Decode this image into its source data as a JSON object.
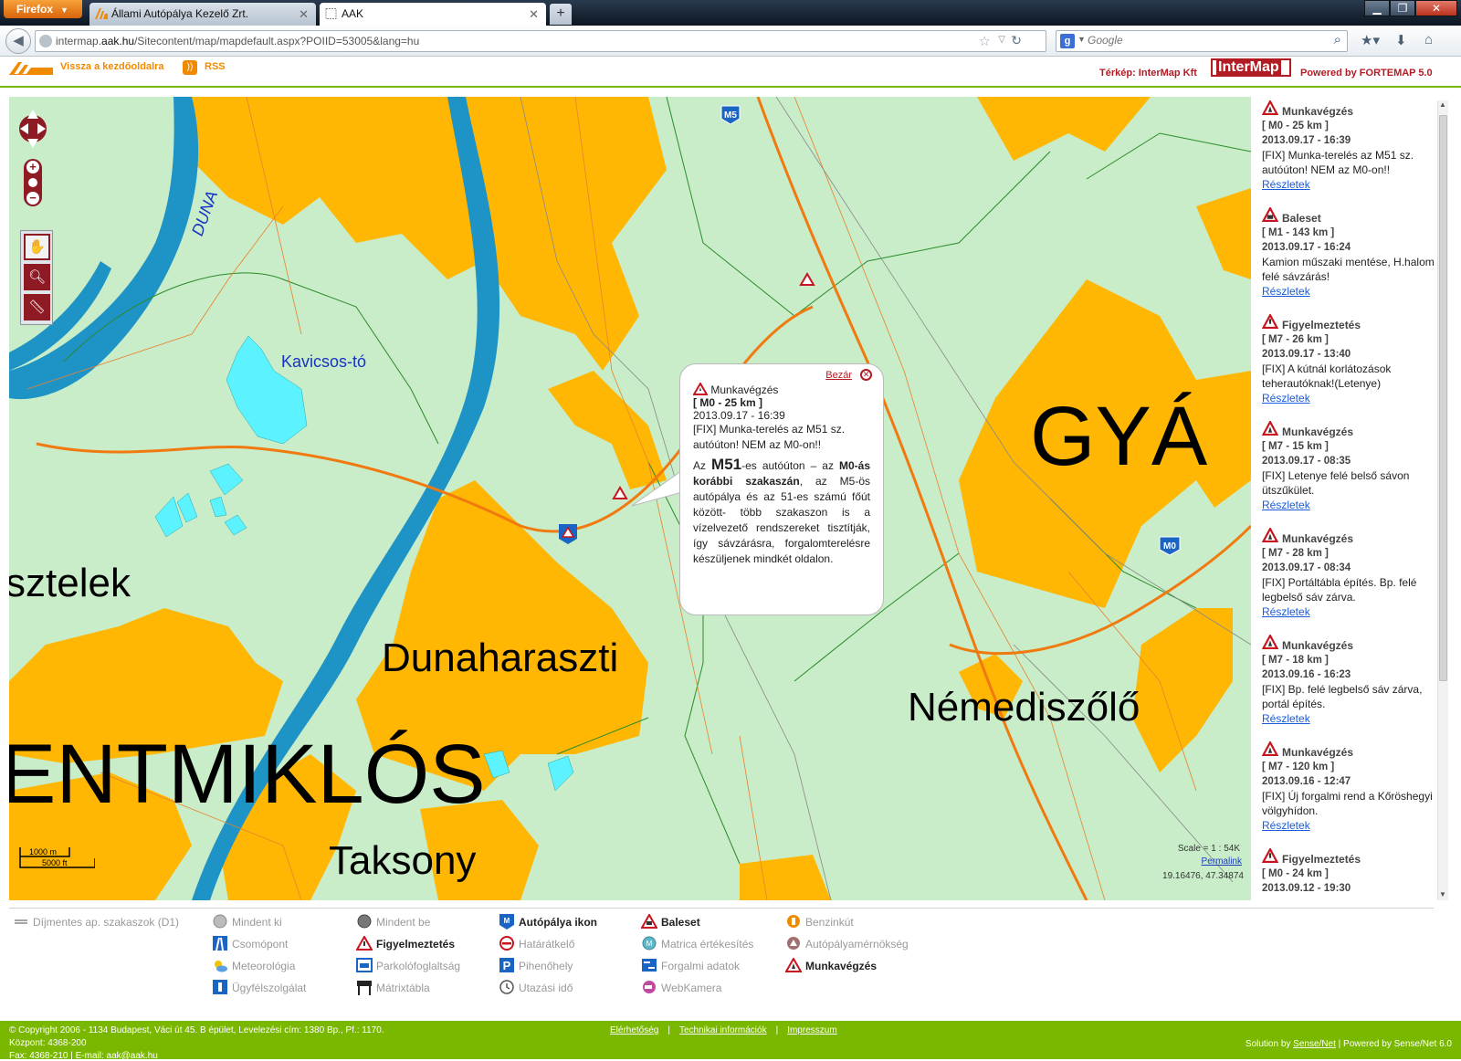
{
  "browser": {
    "menu_label": "Firefox",
    "tabs": [
      {
        "label": "Állami Autópálya Kezelő Zrt."
      },
      {
        "label": "AAK"
      }
    ],
    "url_prefix": "intermap.",
    "url_domain": "aak.hu",
    "url_rest": "/Sitecontent/map/mapdefault.aspx?POIID=53005&lang=hu",
    "search_placeholder": "Google"
  },
  "site_header": {
    "back_link": "Vissza a kezdőoldalra",
    "rss": "RSS",
    "map_credit": "Térkép: InterMap Kft",
    "intermap_logo": "InterMap",
    "powered_by": "Powered by FORTEMAP 5.0"
  },
  "map": {
    "labels": {
      "duna": "DUNA",
      "kavicsos_to": "Kavicsos-tó",
      "gya": "GYÁ",
      "sztelek": "sztelek",
      "dunaharaszti": "Dunaharaszti",
      "nemediszolo": "Némediszőlő",
      "entmiklos": "ENTMIKLÓS",
      "taksony": "Taksony"
    },
    "road_shields": {
      "m5": "M5",
      "m0": "M0"
    },
    "scale_m": "1000 m",
    "scale_ft": "5000 ft",
    "scale_ratio": "Scale = 1 : 54K",
    "permalink": "Permalink",
    "coords": "19.16476, 47.34874"
  },
  "popup": {
    "close_label": "Bezár",
    "type": "Munkavégzés",
    "km": "[ M0 - 25 km ]",
    "date": "2013.09.17 - 16:39",
    "title": "[FIX] Munka-terelés az M51 sz. autóúton! NEM az M0-on!!",
    "body_1": "Az ",
    "body_big": "M51",
    "body_2": "-es autóúton – az ",
    "body_bold": "M0-ás korábbi szakaszán",
    "body_3": ", az M5-ös autópálya és az 51-es számú főút között- több szakaszon is a vízelvezető rendszereket tisztítják, így sávzárásra, forgalomterelésre készüljenek mindkét oldalon."
  },
  "events": [
    {
      "type": "Munkavégzés",
      "km": "[ M0 - 25 km ]",
      "date": "2013.09.17 - 16:39",
      "text": "[FIX] Munka-terelés az M51 sz. autóúton! NEM az M0-on!!",
      "more": "Részletek"
    },
    {
      "type": "Baleset",
      "km": "[ M1 - 143 km ]",
      "date": "2013.09.17 - 16:24",
      "text": "Kamion műszaki mentése, H.halom felé sávzárás!",
      "more": "Részletek"
    },
    {
      "type": "Figyelmeztetés",
      "km": "[ M7 - 26 km ]",
      "date": "2013.09.17 - 13:40",
      "text": "[FIX] A kútnál korlátozások teherautóknak!(Letenye)",
      "more": "Részletek"
    },
    {
      "type": "Munkavégzés",
      "km": "[ M7 - 15 km ]",
      "date": "2013.09.17 - 08:35",
      "text": "[FIX] Letenye felé belső sávon ütszűkület.",
      "more": "Részletek"
    },
    {
      "type": "Munkavégzés",
      "km": "[ M7 - 28 km ]",
      "date": "2013.09.17 - 08:34",
      "text": "[FIX] Portáltábla építés. Bp. felé legbelső sáv zárva.",
      "more": "Részletek"
    },
    {
      "type": "Munkavégzés",
      "km": "[ M7 - 18 km ]",
      "date": "2013.09.16 - 16:23",
      "text": "[FIX] Bp. felé legbelső sáv zárva, portál építés.",
      "more": "Részletek"
    },
    {
      "type": "Munkavégzés",
      "km": "[ M7 - 120 km ]",
      "date": "2013.09.16 - 12:47",
      "text": "[FIX] Új forgalmi rend a Kőröshegyi völgyhídon.",
      "more": "Részletek"
    },
    {
      "type": "Figyelmeztetés",
      "km": "[ M0 - 24 km ]",
      "date": "2013.09.12 - 19:30",
      "text": "",
      "more": ""
    }
  ],
  "legend": {
    "free_sections": "Díjmentes ap. szakaszok (D1)",
    "all_off": "Mindent ki",
    "junction": "Csomópont",
    "meteorology": "Meteorológia",
    "customer_service": "Ügyfélszolgálat",
    "all_on": "Mindent be",
    "warning": "Figyelmeztetés",
    "parking": "Parkolófoglaltság",
    "matrix": "Mátrixtábla",
    "motorway_icon": "Autópálya ikon",
    "border": "Határátkelő",
    "rest_area": "Pihenőhely",
    "travel_time": "Utazási idő",
    "accident": "Baleset",
    "sticker_sales": "Matrica értékesítés",
    "traffic_data": "Forgalmi adatok",
    "webcam": "WebKamera",
    "fuel": "Benzinkút",
    "engineering": "Autópályamérnökség",
    "roadwork": "Munkavégzés"
  },
  "footer": {
    "copyright": "© Copyright 2006 - 1134 Budapest, Váci út 45. B épület, Levelezési cím: 1380 Bp., Pf.: 1170.",
    "central": "Központ: 4368-200",
    "fax": "Fax: 4368-210 | E-mail: aak@aak.hu",
    "links": [
      "Elérhetőség",
      "Technikai információk",
      "Impresszum"
    ],
    "solution_prefix": "Solution by ",
    "solution_link": "Sense/Net",
    "solution_suffix": " | Powered by Sense/Net 6.0"
  },
  "colors": {
    "accent_orange": "#f28a00",
    "brand_red": "#b11c24",
    "footer_green": "#7ab800",
    "urban": "#ffb703",
    "land": "#c8edc8",
    "river": "#1e93c6",
    "lake": "#5cf2ff"
  }
}
